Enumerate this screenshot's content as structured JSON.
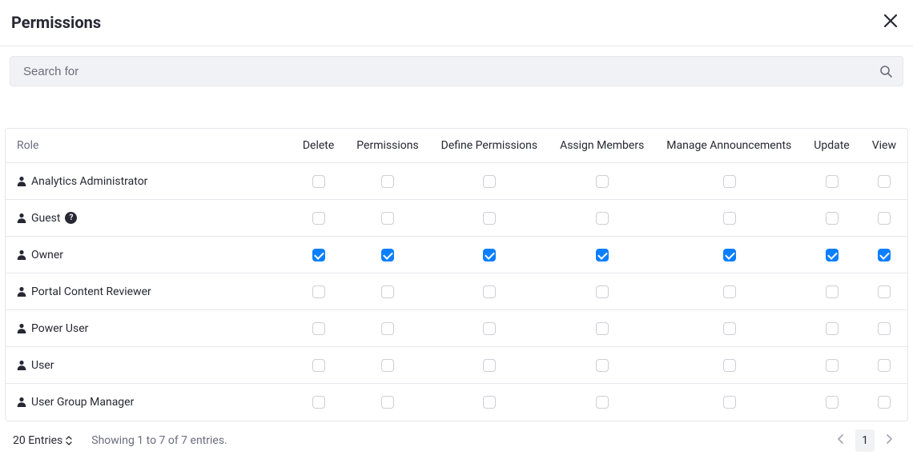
{
  "header": {
    "title": "Permissions"
  },
  "search": {
    "placeholder": "Search for",
    "value": ""
  },
  "table": {
    "columns": [
      "Role",
      "Delete",
      "Permissions",
      "Define Permissions",
      "Assign Members",
      "Manage Announcements",
      "Update",
      "View"
    ],
    "rows": [
      {
        "role": "Analytics Administrator",
        "help": false,
        "perms": [
          false,
          false,
          false,
          false,
          false,
          false,
          false
        ]
      },
      {
        "role": "Guest",
        "help": true,
        "perms": [
          false,
          false,
          false,
          false,
          false,
          false,
          false
        ]
      },
      {
        "role": "Owner",
        "help": false,
        "perms": [
          true,
          true,
          true,
          true,
          true,
          true,
          true
        ]
      },
      {
        "role": "Portal Content Reviewer",
        "help": false,
        "perms": [
          false,
          false,
          false,
          false,
          false,
          false,
          false
        ]
      },
      {
        "role": "Power User",
        "help": false,
        "perms": [
          false,
          false,
          false,
          false,
          false,
          false,
          false
        ]
      },
      {
        "role": "User",
        "help": false,
        "perms": [
          false,
          false,
          false,
          false,
          false,
          false,
          false
        ]
      },
      {
        "role": "User Group Manager",
        "help": false,
        "perms": [
          false,
          false,
          false,
          false,
          false,
          false,
          false
        ]
      }
    ]
  },
  "footer": {
    "page_size_label": "20 Entries",
    "showing": "Showing 1 to 7 of 7 entries.",
    "current_page": "1"
  },
  "icons": {
    "help_glyph": "?"
  }
}
